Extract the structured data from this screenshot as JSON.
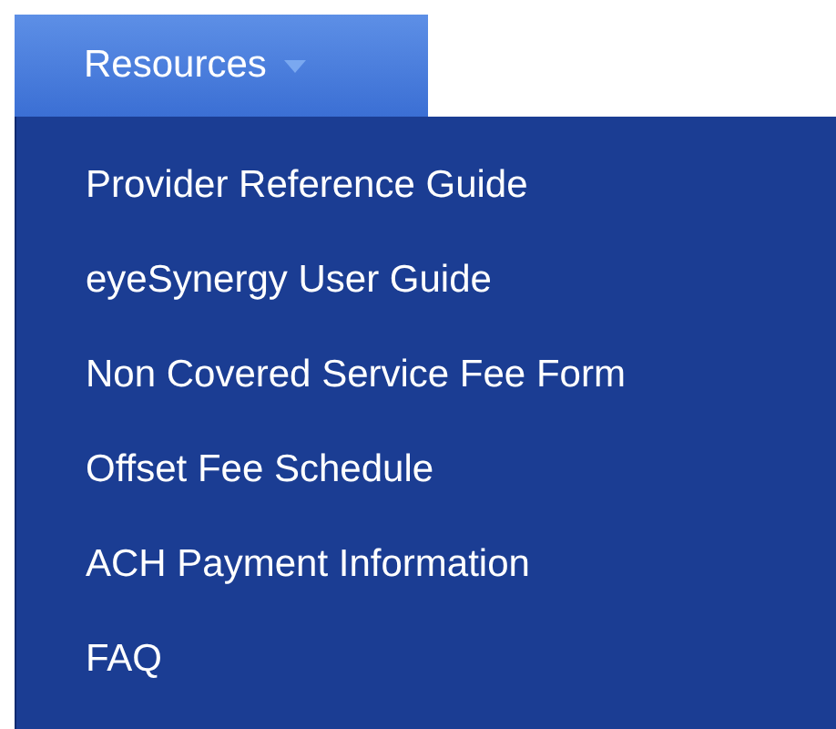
{
  "nav": {
    "label": "Resources",
    "expanded": true
  },
  "menu_items": [
    "Provider Reference Guide",
    "eyeSynergy User Guide",
    "Non Covered Service Fee Form",
    "Offset Fee Schedule",
    "ACH Payment Information",
    "FAQ"
  ]
}
